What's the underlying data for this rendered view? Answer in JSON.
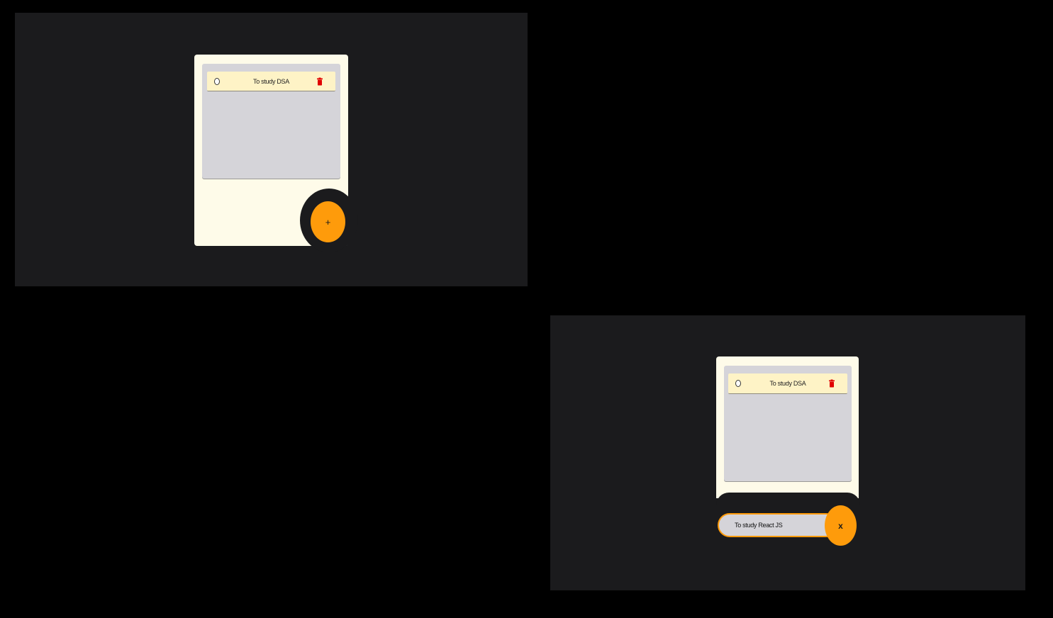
{
  "colors": {
    "page_background": "#000000",
    "panel_background": "#1b1b1d",
    "card_background": "#fefbe9",
    "list_background": "#d5d4d9",
    "item_background": "#fef3c6",
    "accent": "#fe9b0b",
    "delete_icon": "#e00000"
  },
  "screen_a": {
    "todos": [
      {
        "text": "To study DSA",
        "done": false,
        "check_icon": "empty-circle-icon",
        "delete_icon": "trash-icon"
      }
    ],
    "fab_label": "+",
    "fab_icon": "plus-icon"
  },
  "screen_b": {
    "todos": [
      {
        "text": "To study DSA",
        "done": false,
        "check_icon": "empty-circle-icon",
        "delete_icon": "trash-icon"
      }
    ],
    "input": {
      "value": "To study React JS",
      "placeholder": ""
    },
    "fab_label": "x",
    "fab_icon": "close-icon"
  }
}
